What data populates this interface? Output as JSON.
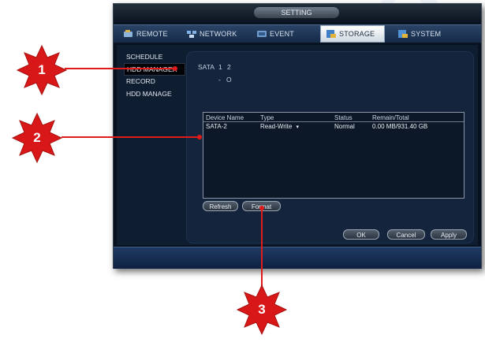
{
  "window": {
    "title": "SETTING"
  },
  "tabs": [
    {
      "label": "REMOTE",
      "icon": "remote-icon",
      "active": false
    },
    {
      "label": "NETWORK",
      "icon": "network-icon",
      "active": false
    },
    {
      "label": "EVENT",
      "icon": "event-icon",
      "active": false
    },
    {
      "label": "STORAGE",
      "icon": "storage-icon",
      "active": true
    },
    {
      "label": "SYSTEM",
      "icon": "system-icon",
      "active": false
    }
  ],
  "sidebar": {
    "items": [
      {
        "label": "SCHEDULE",
        "selected": false
      },
      {
        "label": "HDD MANAGER",
        "selected": true
      },
      {
        "label": "RECORD",
        "selected": false
      },
      {
        "label": "HDD MANAGE",
        "selected": false
      }
    ]
  },
  "sata": {
    "label": "SATA",
    "ports": [
      "1",
      "2"
    ],
    "status_row": [
      "-",
      "O"
    ]
  },
  "table": {
    "headers": [
      "Device Name",
      "Type",
      "Status",
      "Remain/Total"
    ],
    "rows": [
      {
        "device": "SATA-2",
        "type": "Read-Write",
        "status": "Normal",
        "remain_total": "0.00 MB/931.40 GB"
      }
    ]
  },
  "buttons": {
    "refresh": "Refresh",
    "format": "Format",
    "ok": "OK",
    "cancel": "Cancel",
    "apply": "Apply"
  },
  "callouts": [
    "1",
    "2",
    "3"
  ],
  "colors": {
    "accent_red": "#e11a1a",
    "tab_bar": "#1f3a5e",
    "window_bg": "#08121e"
  }
}
